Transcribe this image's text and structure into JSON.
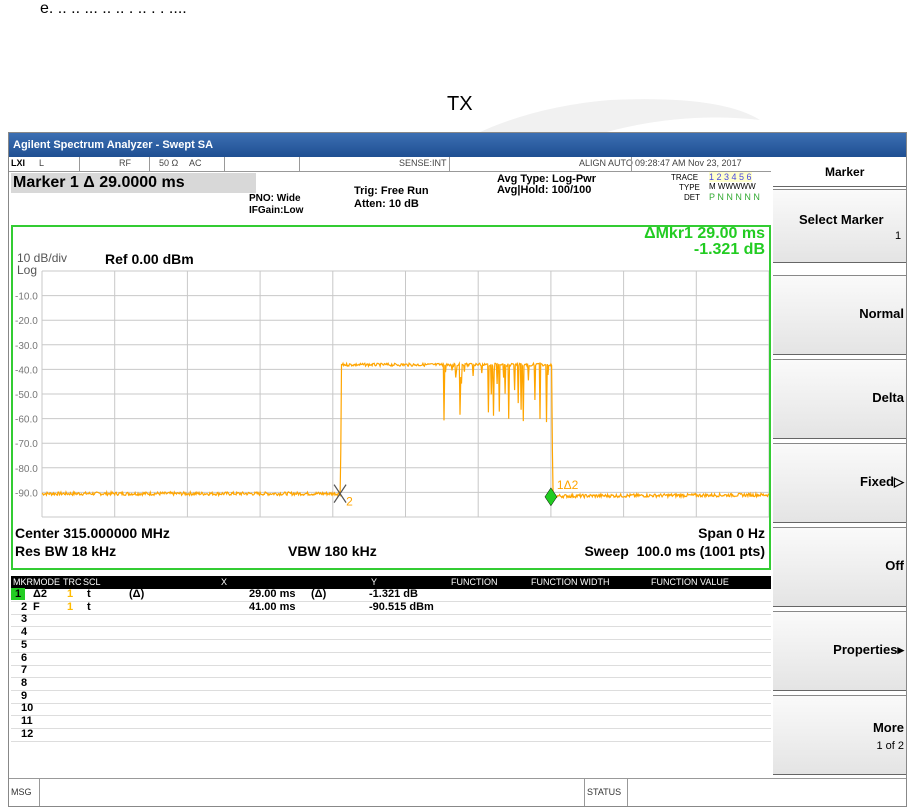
{
  "document": {
    "caption": "TX",
    "top_fragment": "e. .. .. ... .. .. . .. . . ...."
  },
  "window": {
    "title": "Agilent Spectrum Analyzer - Swept SA"
  },
  "status_row": {
    "logo": "LXI",
    "mode": "L",
    "rf": "RF",
    "impedance": "50 Ω",
    "coupling": "AC",
    "sense": "SENSE:INT",
    "align": "ALIGN AUTO",
    "datetime": "09:28:47 AM Nov 23, 2017"
  },
  "header": {
    "marker_readout": "Marker 1 Δ 29.0000 ms",
    "pno": "PNO: Wide",
    "ifgain": "IFGain:Low",
    "trig": "Trig: Free Run",
    "atten": "Atten: 10 dB",
    "avg_type": "Avg Type: Log-Pwr",
    "avg_hold": "Avg|Hold: 100/100",
    "trace_label": "TRACE",
    "trace_values": "1 2 3 4 5 6",
    "type_label": "TYPE",
    "type_values": "M WWWWW",
    "det_label": "DET",
    "det_values": "P N N N N N"
  },
  "display": {
    "scale": "10 dB/div",
    "scale_type": "Log",
    "ref_level": "Ref 0.00 dBm",
    "delta_marker_line1": "ΔMkr1 29.00 ms",
    "delta_marker_line2": "-1.321 dB",
    "center": "Center 315.000000 MHz",
    "span": "Span 0 Hz",
    "res_bw": "Res BW 18 kHz",
    "vbw": "VBW 180 kHz",
    "sweep": "Sweep  100.0 ms (1001 pts)",
    "marker1_label": "1Δ2",
    "marker2_label": "2",
    "trace_color": "#ffa500",
    "border_color": "#33cc33",
    "marker_color": "#22cc22"
  },
  "chart_data": {
    "type": "line",
    "title": "",
    "xlabel": "",
    "ylabel": "",
    "ylim": [
      -100,
      0
    ],
    "xlim": [
      0,
      100
    ],
    "x_unit": "ms",
    "y_unit": "dBm",
    "y_ticks": [
      "-10.0",
      "-20.0",
      "-30.0",
      "-40.0",
      "-50.0",
      "-60.0",
      "-70.0",
      "-80.0",
      "-90.0"
    ],
    "y_tick_values": [
      -10,
      -20,
      -30,
      -40,
      -50,
      -60,
      -70,
      -80,
      -90
    ],
    "grid": true,
    "series": [
      {
        "x": [
          0,
          41.0,
          41.3,
          55.0,
          55.5,
          70.0,
          70.3,
          100
        ],
        "y": [
          -90.5,
          -90.5,
          -38.0,
          -38.0,
          -45.0,
          -38.0,
          -91.5,
          -91.0
        ]
      }
    ],
    "markers": [
      {
        "label": "1Δ2",
        "x": 70.0,
        "y": -91.8
      },
      {
        "label": "2",
        "x": 41.0,
        "y": -90.5
      }
    ]
  },
  "marker_table": {
    "headers": [
      "MKR",
      "MODE",
      "TRC",
      "SCL",
      "X",
      "Y",
      "FUNCTION",
      "FUNCTION WIDTH",
      "FUNCTION VALUE"
    ],
    "rows": [
      {
        "mkr": "1",
        "mode": "Δ2",
        "trc": "1",
        "scl": "t",
        "x_mode": "(Δ)",
        "x": "29.00 ms",
        "y_mode": "(Δ)",
        "y": "-1.321 dB"
      },
      {
        "mkr": "2",
        "mode": "F",
        "trc": "1",
        "scl": "t",
        "x_mode": "",
        "x": "41.00 ms",
        "y_mode": "",
        "y": "-90.515 dBm"
      },
      {
        "mkr": "3"
      },
      {
        "mkr": "4"
      },
      {
        "mkr": "5"
      },
      {
        "mkr": "6"
      },
      {
        "mkr": "7"
      },
      {
        "mkr": "8"
      },
      {
        "mkr": "9"
      },
      {
        "mkr": "10"
      },
      {
        "mkr": "11"
      },
      {
        "mkr": "12"
      }
    ]
  },
  "msg_bar": {
    "msg": "MSG",
    "status": "STATUS"
  },
  "softkeys": {
    "title": "Marker",
    "select_marker": "Select Marker",
    "select_marker_value": "1",
    "normal": "Normal",
    "delta": "Delta",
    "fixed": "Fixed▷",
    "off": "Off",
    "properties": "Properties▸",
    "more": "More",
    "more_page": "1 of 2"
  }
}
